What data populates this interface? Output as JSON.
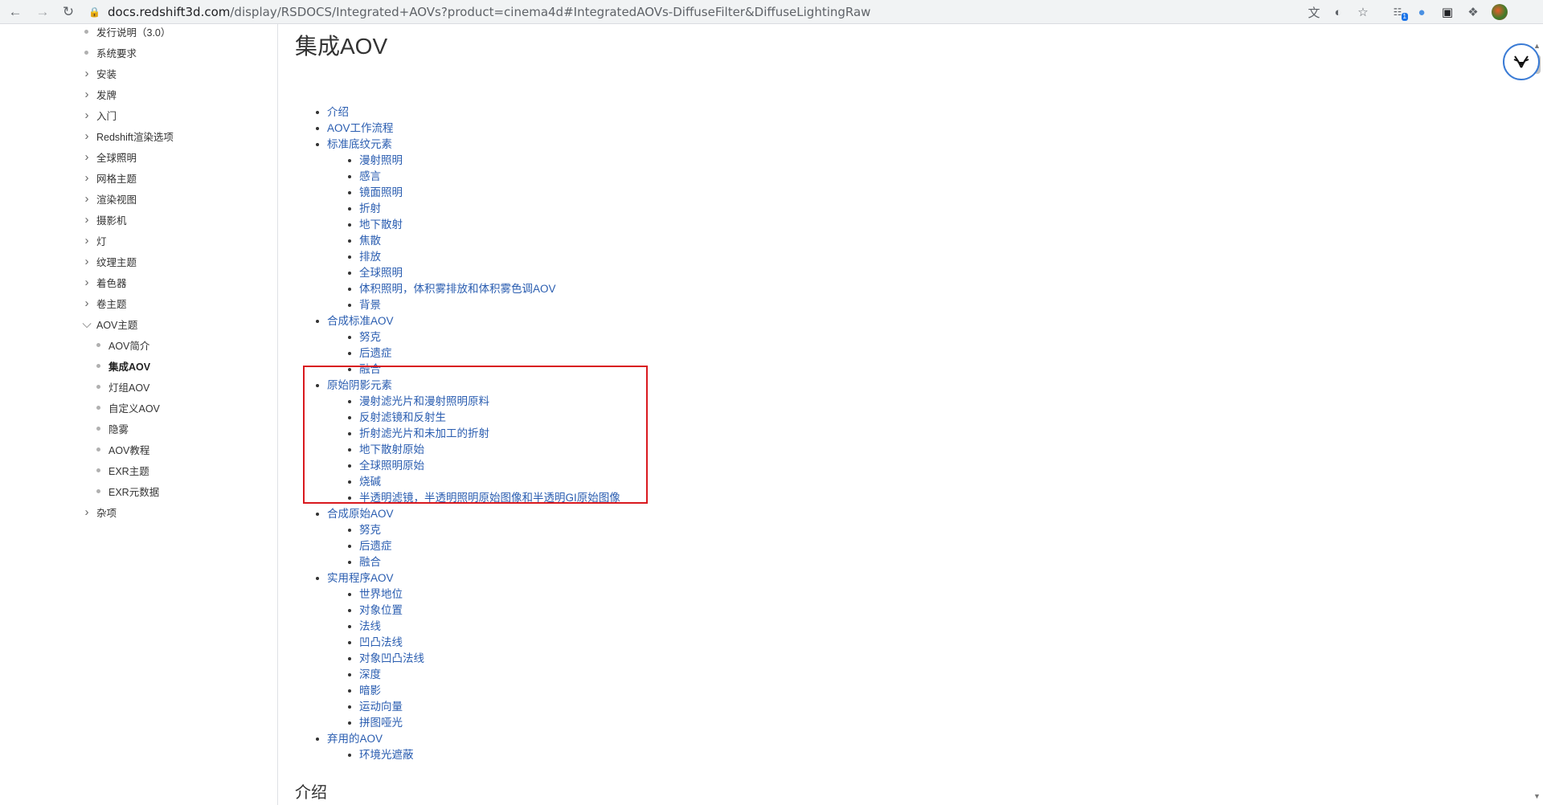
{
  "browser": {
    "url_host": "docs.redshift3d.com",
    "url_path": "/display/RSDOCS/Integrated+AOVs?product=cinema4d#IntegratedAOVs-DiffuseFilter&DiffuseLightingRaw",
    "icons": [
      "back-icon",
      "forward-icon",
      "reload-icon",
      "lock-icon",
      "translate-icon",
      "eye-off-icon",
      "star-icon",
      "extension-icon",
      "globe-icon",
      "tablet-icon",
      "puzzle-icon",
      "profile-icon"
    ],
    "extension_badge": "1"
  },
  "sidebar": {
    "items": [
      {
        "label": "发行说明（3.0）",
        "type": "dot",
        "level": 1
      },
      {
        "label": "系统要求",
        "type": "dot",
        "level": 1
      },
      {
        "label": "安装",
        "type": "chevron",
        "level": 1
      },
      {
        "label": "发牌",
        "type": "chevron",
        "level": 1
      },
      {
        "label": "入门",
        "type": "chevron",
        "level": 1
      },
      {
        "label": "Redshift渲染选项",
        "type": "chevron",
        "level": 1
      },
      {
        "label": "全球照明",
        "type": "chevron",
        "level": 1
      },
      {
        "label": "网格主题",
        "type": "chevron",
        "level": 1
      },
      {
        "label": "渲染视图",
        "type": "chevron",
        "level": 1
      },
      {
        "label": "摄影机",
        "type": "chevron",
        "level": 1
      },
      {
        "label": "灯",
        "type": "chevron",
        "level": 1
      },
      {
        "label": "纹理主题",
        "type": "chevron",
        "level": 1
      },
      {
        "label": "着色器",
        "type": "chevron",
        "level": 1
      },
      {
        "label": "卷主题",
        "type": "chevron",
        "level": 1
      },
      {
        "label": "AOV主题",
        "type": "chevron-open",
        "level": 1
      },
      {
        "label": "AOV简介",
        "type": "dot",
        "level": 2
      },
      {
        "label": "集成AOV",
        "type": "dot",
        "level": 2,
        "active": true
      },
      {
        "label": "灯组AOV",
        "type": "dot",
        "level": 2
      },
      {
        "label": "自定义AOV",
        "type": "dot",
        "level": 2
      },
      {
        "label": "隐雾",
        "type": "dot",
        "level": 2
      },
      {
        "label": "AOV教程",
        "type": "dot",
        "level": 2
      },
      {
        "label": "EXR主题",
        "type": "dot",
        "level": 2
      },
      {
        "label": "EXR元数据",
        "type": "dot",
        "level": 2
      },
      {
        "label": "杂项",
        "type": "chevron",
        "level": 1
      }
    ]
  },
  "main": {
    "title": "集成AOV",
    "toc": [
      {
        "label": "介绍",
        "level": 1
      },
      {
        "label": "AOV工作流程",
        "level": 1
      },
      {
        "label": "标准底纹元素",
        "level": 1
      },
      {
        "label": "漫射照明",
        "level": 2
      },
      {
        "label": "感言",
        "level": 2
      },
      {
        "label": "镜面照明",
        "level": 2
      },
      {
        "label": "折射",
        "level": 2
      },
      {
        "label": "地下散射",
        "level": 2
      },
      {
        "label": "焦散",
        "level": 2
      },
      {
        "label": "排放",
        "level": 2
      },
      {
        "label": "全球照明",
        "level": 2
      },
      {
        "label": "体积照明，体积雾排放和体积雾色调AOV",
        "level": 2
      },
      {
        "label": "背景",
        "level": 2
      },
      {
        "label": "合成标准AOV",
        "level": 1
      },
      {
        "label": "努克",
        "level": 2
      },
      {
        "label": "后遗症",
        "level": 2
      },
      {
        "label": "融合",
        "level": 2
      },
      {
        "label": "原始阴影元素",
        "level": 1
      },
      {
        "label": "漫射滤光片和漫射照明原料",
        "level": 2
      },
      {
        "label": "反射滤镜和反射生",
        "level": 2
      },
      {
        "label": "折射滤光片和未加工的折射",
        "level": 2
      },
      {
        "label": "地下散射原始",
        "level": 2
      },
      {
        "label": "全球照明原始",
        "level": 2
      },
      {
        "label": "烧碱",
        "level": 2
      },
      {
        "label": "半透明滤镜，半透明照明原始图像和半透明GI原始图像",
        "level": 2
      },
      {
        "label": "合成原始AOV",
        "level": 1
      },
      {
        "label": "努克",
        "level": 2
      },
      {
        "label": "后遗症",
        "level": 2
      },
      {
        "label": "融合",
        "level": 2
      },
      {
        "label": "实用程序AOV",
        "level": 1
      },
      {
        "label": "世界地位",
        "level": 2
      },
      {
        "label": "对象位置",
        "level": 2
      },
      {
        "label": "法线",
        "level": 2
      },
      {
        "label": "凹凸法线",
        "level": 2
      },
      {
        "label": "对象凹凸法线",
        "level": 2
      },
      {
        "label": "深度",
        "level": 2
      },
      {
        "label": "暗影",
        "level": 2
      },
      {
        "label": "运动向量",
        "level": 2
      },
      {
        "label": "拼图哑光",
        "level": 2
      },
      {
        "label": "弃用的AOV",
        "level": 1
      },
      {
        "label": "环境光遮蔽",
        "level": 2
      }
    ],
    "section_heading": "介绍",
    "highlight_color": "#d9191f",
    "link_color": "#2a5db0"
  }
}
